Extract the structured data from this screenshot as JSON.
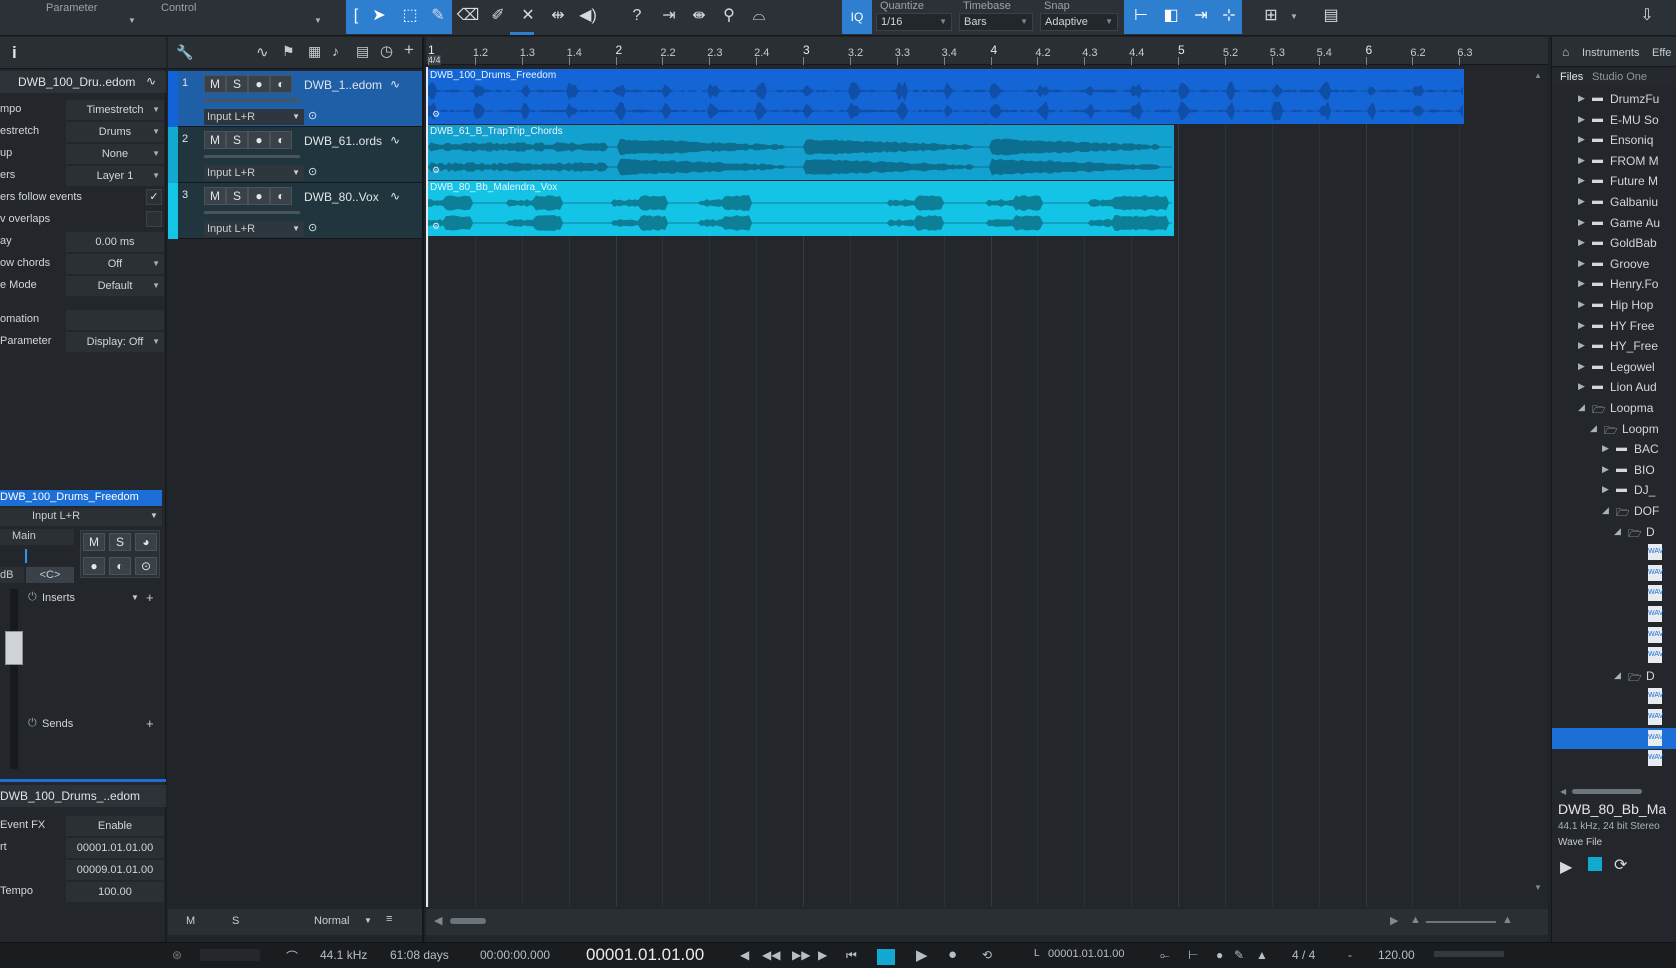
{
  "toolbar": {
    "param_label": "Parameter",
    "control_label": "Control",
    "quantize_label": "Quantize",
    "quantize_value": "1/16",
    "timebase_label": "Timebase",
    "timebase_value": "Bars",
    "snap_label": "Snap",
    "snap_value": "Adaptive",
    "iq_label": "IQ"
  },
  "inspector": {
    "info_label": "i",
    "track_name": "DWB_100_Dru..edom",
    "rows": [
      {
        "label": "mpo",
        "value": "Timestretch"
      },
      {
        "label": "estretch",
        "value": "Drums"
      },
      {
        "label": "up",
        "value": "None"
      },
      {
        "label": "ers",
        "value": "Layer 1"
      },
      {
        "label": "ers follow events",
        "value": ""
      },
      {
        "label": "v overlaps",
        "value": ""
      },
      {
        "label": "ay",
        "value": "0.00 ms"
      },
      {
        "label": "ow chords",
        "value": "Off"
      },
      {
        "label": "e Mode",
        "value": "Default"
      },
      {
        "label": "omation",
        "value": ""
      },
      {
        "label": "Parameter",
        "value": "Display: Off"
      }
    ],
    "channel_name": "DWB_100_Drums_Freedom",
    "channel_input": "Input L+R",
    "channel_output": "Main",
    "pan_label": "<C>",
    "db_label": "dB",
    "inserts_label": "Inserts",
    "sends_label": "Sends",
    "event_name": "DWB_100_Drums_..edom",
    "event_rows": [
      {
        "label": "Event FX",
        "value": "Enable"
      },
      {
        "label": "rt",
        "value": "00001.01.01.00"
      },
      {
        "label": "",
        "value": "00009.01.01.00"
      },
      {
        "label": "Tempo",
        "value": "100.00"
      }
    ]
  },
  "tracks": [
    {
      "num": "1",
      "name": "DWB_1..edom",
      "input": "Input L+R",
      "color": "#1363d8",
      "selected": true
    },
    {
      "num": "2",
      "name": "DWB_61..ords",
      "input": "Input L+R",
      "color": "#13a8d0",
      "selected": false
    },
    {
      "num": "3",
      "name": "DWB_80..Vox",
      "input": "Input L+R",
      "color": "#13c6e8",
      "selected": false
    }
  ],
  "msr_labels": {
    "m": "M",
    "s": "S"
  },
  "ruler": {
    "signature": "4/4",
    "ticks": [
      "1",
      "1.2",
      "1.3",
      "1.4",
      "2",
      "2.2",
      "2.3",
      "2.4",
      "3",
      "3.2",
      "3.3",
      "3.4",
      "4",
      "4.2",
      "4.3",
      "4.4",
      "5",
      "5.2",
      "5.3",
      "5.4",
      "6",
      "6.2",
      "6.3"
    ]
  },
  "clips": [
    {
      "name": "DWB_100_Drums_Freedom",
      "color": "#1465d6",
      "wave": "#0f4fa8"
    },
    {
      "name": "DWB_61_B_TrapTrip_Chords",
      "color": "#13a2cf",
      "wave": "#0d6f8f"
    },
    {
      "name": "DWB_80_Bb_Malendra_Vox",
      "color": "#13c4e6",
      "wave": "#0d7f97"
    }
  ],
  "bottom_bar": {
    "m": "M",
    "s": "S",
    "mode": "Normal"
  },
  "browser": {
    "tabs": [
      "Instruments",
      "Effe"
    ],
    "subtabs": [
      "Files",
      "Studio One"
    ],
    "items": [
      "DrumzFu",
      "E-MU So",
      "Ensoniq",
      "FROM M",
      "Future M",
      "Galbaniu",
      "Game Au",
      "GoldBab",
      "Groove",
      "Henry.Fo",
      "Hip Hop",
      "HY Free",
      "HY_Free",
      "Legowel",
      "Lion Aud",
      "Loopma",
      "Loopm",
      "BAC",
      "BIO",
      "DJ_",
      "DOF",
      "D",
      "",
      "",
      "",
      "",
      "",
      "",
      "D",
      "",
      "",
      "",
      ""
    ],
    "file_name": "DWB_80_Bb_Ma",
    "file_info": "44.1 kHz, 24 bit Stereo",
    "file_type": "Wave File"
  },
  "status": {
    "sample_rate": "44.1 kHz",
    "record_time": "61:08 days",
    "time": "00:00:00.000",
    "bars": "00001.01.01.00",
    "loop_start": "00001.01.01.00",
    "signature": "4 / 4",
    "separator": "-",
    "tempo": "120.00",
    "loop_marker": "L"
  }
}
